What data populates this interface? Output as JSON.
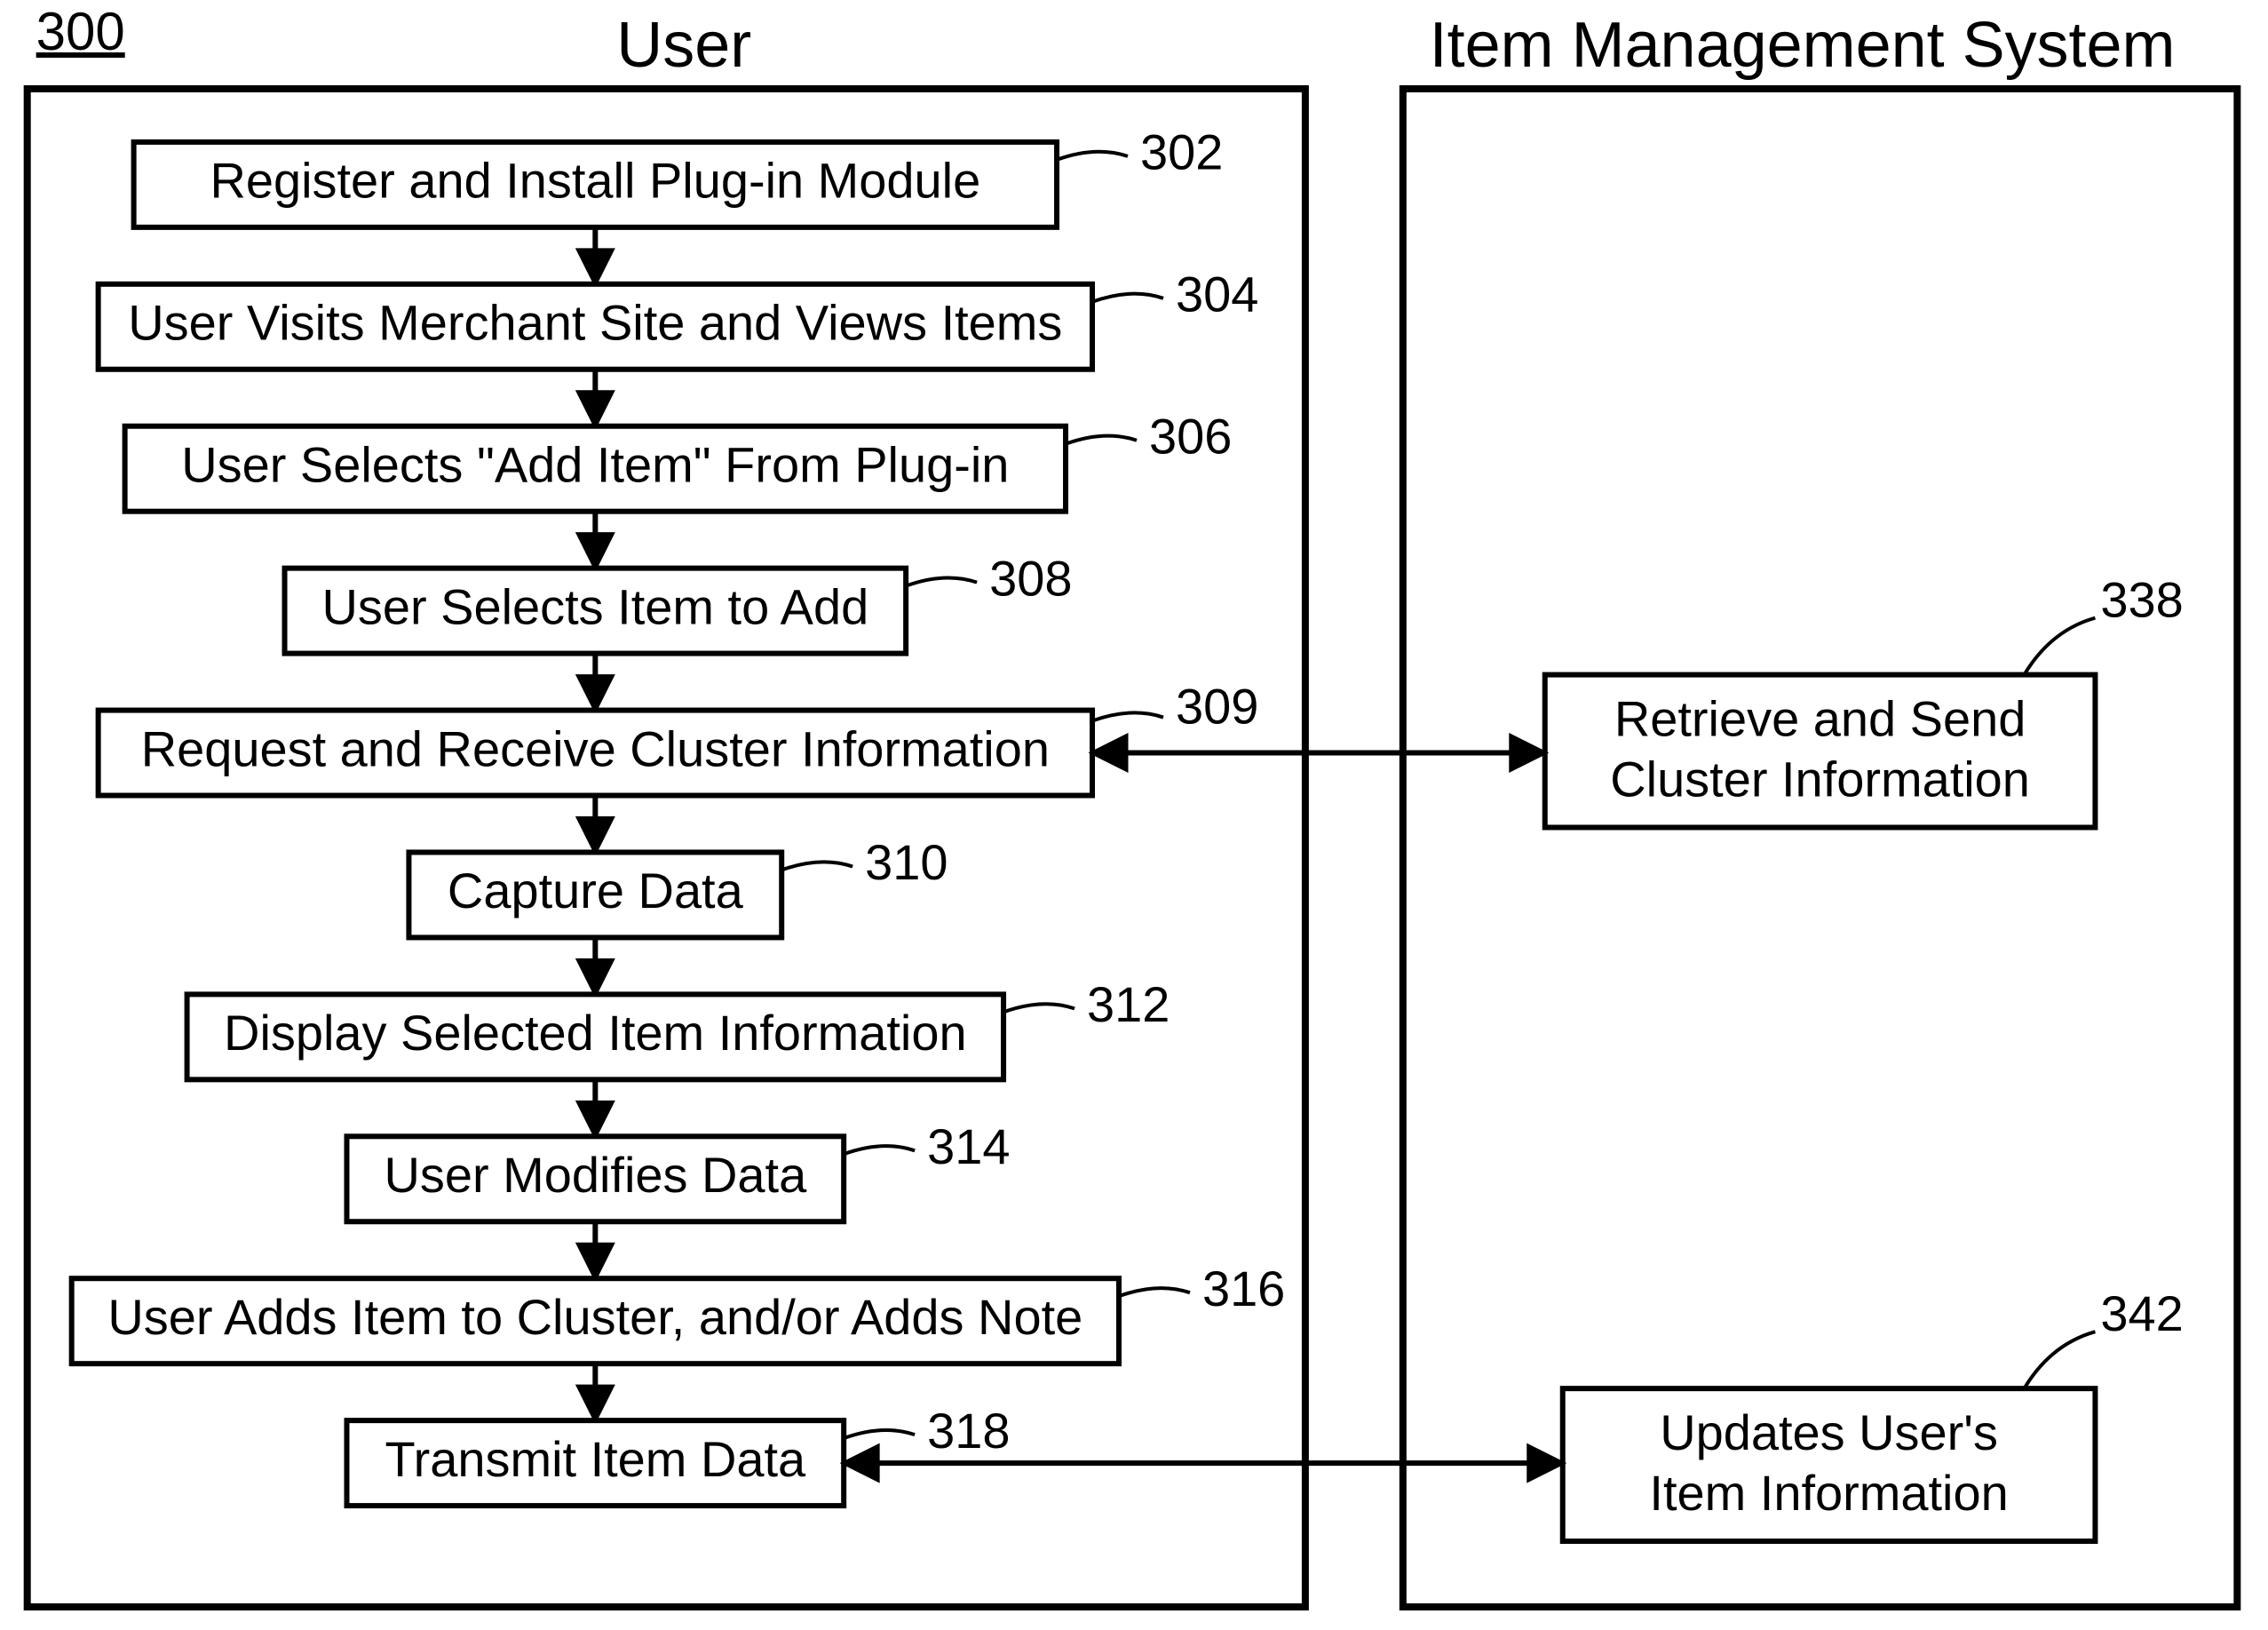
{
  "figure_ref": "300",
  "titles": {
    "left": "User",
    "right": "Item Management System"
  },
  "left_steps": [
    {
      "id": "302",
      "text": "Register and Install Plug-in Module"
    },
    {
      "id": "304",
      "text": "User Visits Merchant Site and Views Items"
    },
    {
      "id": "306",
      "text": "User Selects \"Add Item\" From Plug-in"
    },
    {
      "id": "308",
      "text": "User Selects Item to Add"
    },
    {
      "id": "309",
      "text": "Request and Receive Cluster Information"
    },
    {
      "id": "310",
      "text": "Capture Data"
    },
    {
      "id": "312",
      "text": "Display Selected Item Information"
    },
    {
      "id": "314",
      "text": "User Modifies Data"
    },
    {
      "id": "316",
      "text": "User Adds Item to Cluster, and/or Adds Note"
    },
    {
      "id": "318",
      "text": "Transmit Item Data"
    }
  ],
  "right_steps": [
    {
      "id": "338",
      "line1": "Retrieve and Send",
      "line2": "Cluster Information"
    },
    {
      "id": "342",
      "line1": "Updates User's",
      "line2": "Item Information"
    }
  ]
}
